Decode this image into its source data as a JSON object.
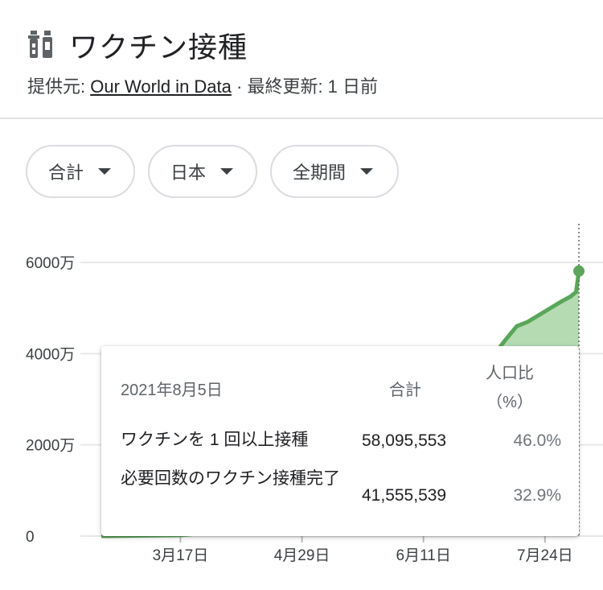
{
  "header": {
    "title": "ワクチン接種",
    "source_prefix": "提供元: ",
    "source_link": "Our World in Data",
    "updated": " · 最終更新: 1 日前"
  },
  "filters": [
    {
      "label": "合計"
    },
    {
      "label": "日本"
    },
    {
      "label": "全期間"
    }
  ],
  "colors": {
    "line": "#5aa65a",
    "fill": "#a8d5a4",
    "grid": "#e8e8e8"
  },
  "chart_data": {
    "type": "area",
    "y_ticks": [
      "6000万",
      "4000万",
      "2000万",
      "0"
    ],
    "x_ticks": [
      "3月17日",
      "4月29日",
      "6月11日",
      "7月24日"
    ],
    "ylim": [
      0,
      65000000
    ],
    "series": [
      {
        "x": [
          "2021-02-17",
          "2021-03-17",
          "2021-04-29",
          "2021-06-11",
          "2021-06-30",
          "2021-07-05",
          "2021-07-10",
          "2021-07-14",
          "2021-07-18",
          "2021-07-22",
          "2021-07-26",
          "2021-07-30",
          "2021-08-02",
          "2021-08-04",
          "2021-08-05"
        ],
        "values": [
          0,
          200000,
          2500000,
          20000000,
          35000000,
          39000000,
          43000000,
          46000000,
          47000000,
          48500000,
          50000000,
          51500000,
          52500000,
          53500000,
          58095553
        ]
      }
    ]
  },
  "tooltip": {
    "date": "2021年8月5日",
    "col_total": "合計",
    "col_pop_1": "人口比",
    "col_pop_2": "（%）",
    "rows": [
      {
        "label": "ワクチンを 1 回以上接種",
        "value": "58,095,553",
        "pct": "46.0%"
      },
      {
        "label": "必要回数のワクチン接種完了",
        "value": "41,555,539",
        "pct": "32.9%"
      }
    ]
  }
}
